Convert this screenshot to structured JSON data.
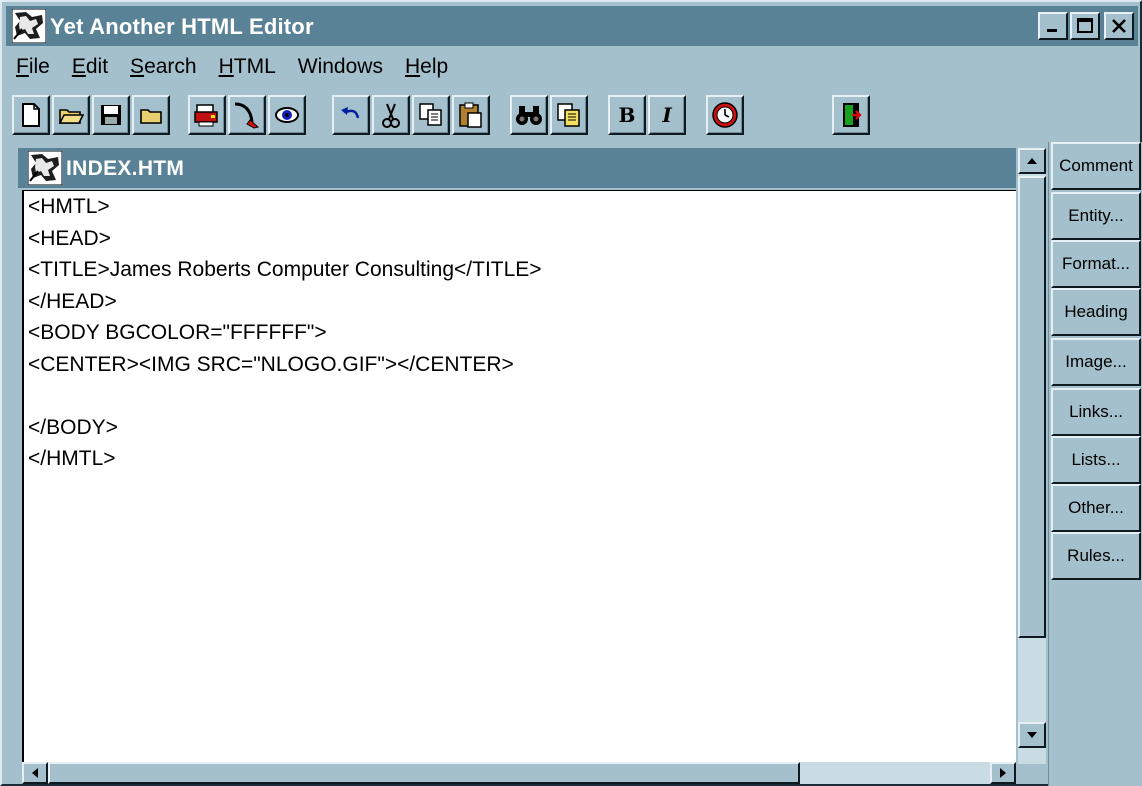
{
  "window": {
    "title": "Yet Another HTML Editor",
    "icon": "editor-app-icon",
    "controls": [
      "minimize",
      "maximize",
      "close"
    ]
  },
  "menu": [
    {
      "label": "File",
      "accel": "F"
    },
    {
      "label": "Edit",
      "accel": "E"
    },
    {
      "label": "Search",
      "accel": "S"
    },
    {
      "label": "HTML",
      "accel": "H"
    },
    {
      "label": "Windows",
      "accel": ""
    },
    {
      "label": "Help",
      "accel": "H"
    }
  ],
  "toolbar": {
    "buttons": [
      "new-file-icon",
      "open-folder-icon",
      "save-icon",
      "folder-icon",
      "print-icon",
      "brush-icon",
      "preview-eye-icon",
      "undo-icon",
      "cut-icon",
      "copy-icon",
      "paste-icon",
      "find-binoculars-icon",
      "replace-icon",
      "bold-icon",
      "italic-icon",
      "clock-icon",
      "exit-door-icon"
    ],
    "bold_label": "B",
    "italic_label": "I"
  },
  "document": {
    "title": "INDEX.HTM",
    "lines": [
      "<HMTL>",
      "<HEAD>",
      "<TITLE>James Roberts Computer Consulting</TITLE>",
      "</HEAD>",
      "<BODY BGCOLOR=\"FFFFFF\">",
      "<CENTER><IMG SRC=\"NLOGO.GIF\"></CENTER>",
      "",
      "</BODY>",
      "</HMTL>"
    ]
  },
  "tag_buttons": [
    "Comment",
    "Entity...",
    "Format...",
    "Heading",
    "Image...",
    "Links...",
    "Lists...",
    "Other...",
    "Rules..."
  ],
  "colors": {
    "titlebar": "#5a8296",
    "face": "#a4c0cc",
    "editor_bg": "#ffffff"
  }
}
